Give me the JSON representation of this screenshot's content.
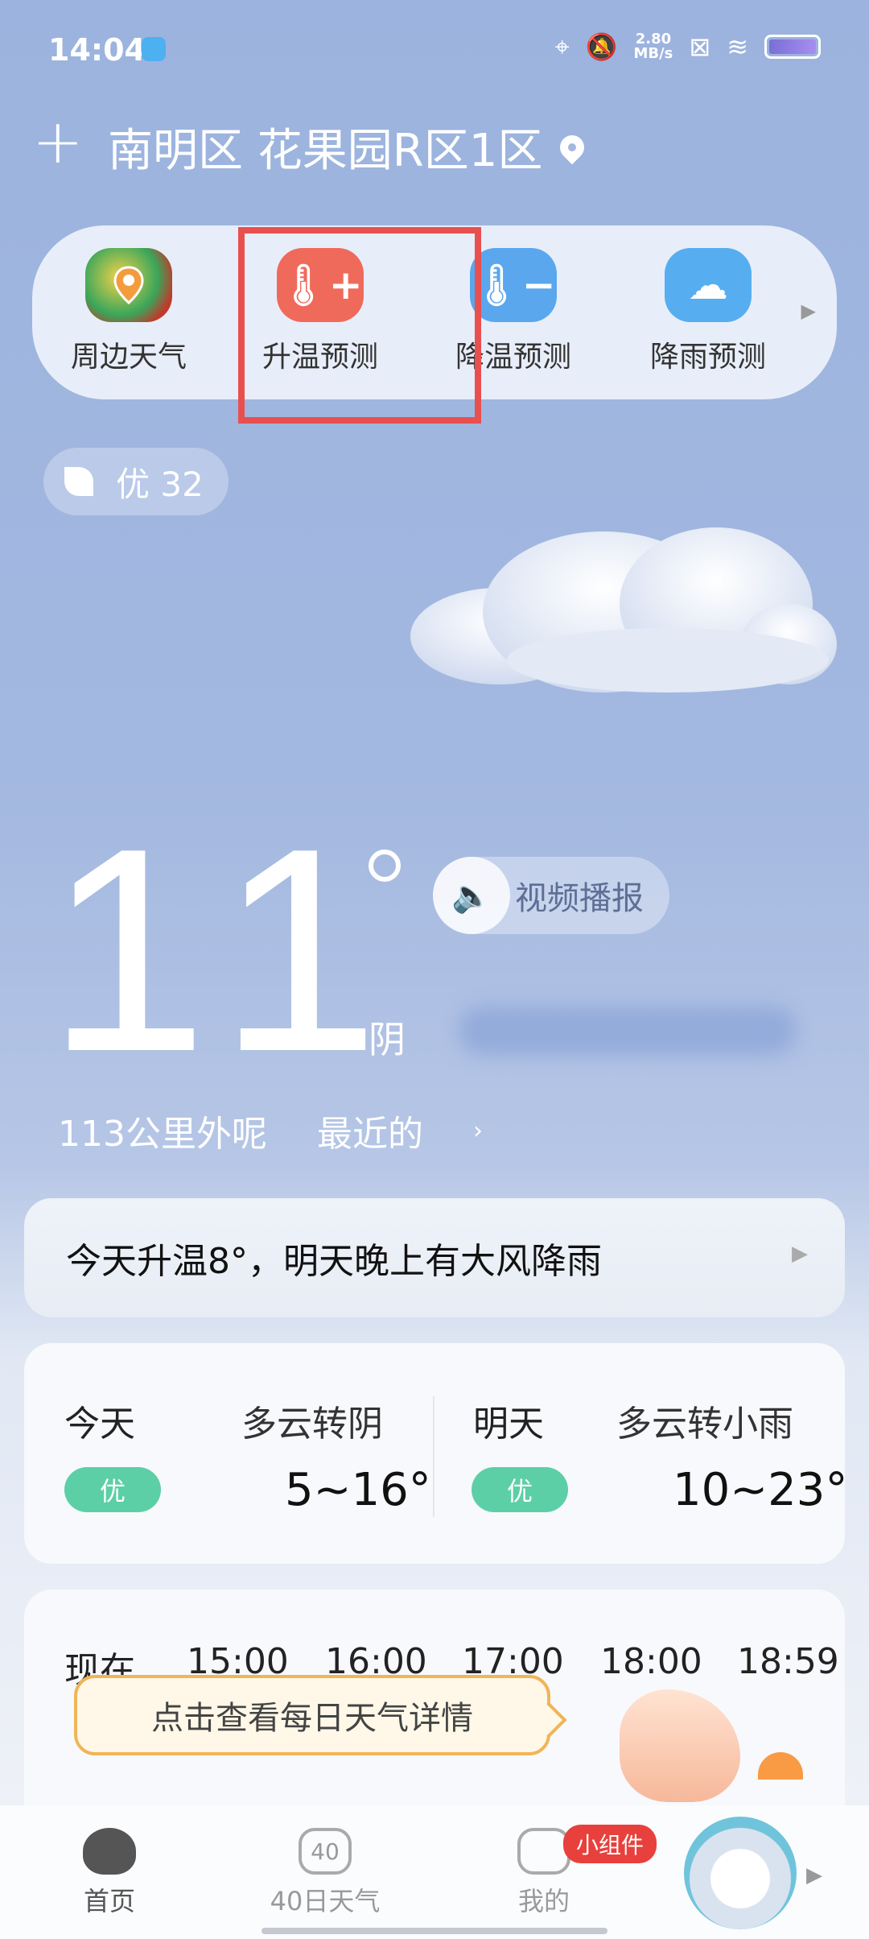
{
  "status_bar": {
    "time": "14:04",
    "net_speed_value": "2.80",
    "net_speed_unit": "MB/s"
  },
  "header": {
    "location": "南明区 花果园R区1区"
  },
  "shortcuts": [
    {
      "label": "周边天气",
      "icon": "map-pin-icon"
    },
    {
      "label": "升温预测",
      "icon": "thermometer-plus-icon"
    },
    {
      "label": "降温预测",
      "icon": "thermometer-minus-icon"
    },
    {
      "label": "降雨预测",
      "icon": "rain-cloud-icon"
    }
  ],
  "aqi": {
    "label": "优 32"
  },
  "current": {
    "temperature": "11",
    "condition": "阴",
    "video_label": "视频播报",
    "ticker_part1": "113公里外呢",
    "ticker_part2": "最近的"
  },
  "alert": {
    "text": "今天升温8°，明天晚上有大风降雨"
  },
  "forecast": {
    "today": {
      "day": "今天",
      "condition": "多云转阴",
      "aqi": "优",
      "range": "5~16°"
    },
    "tomorrow": {
      "day": "明天",
      "condition": "多云转小雨",
      "aqi": "优",
      "range": "10~23°"
    }
  },
  "hourly": {
    "hours": [
      "现在",
      "15:00",
      "16:00",
      "17:00",
      "18:00",
      "18:59"
    ],
    "tip": "点击查看每日天气详情"
  },
  "bottom_nav": {
    "items": [
      {
        "label": "首页"
      },
      {
        "label": "40日天气",
        "icon_text": "40"
      },
      {
        "label": "我的"
      }
    ],
    "badge": "小组件"
  },
  "colors": {
    "accent_warm": "#f06a5c",
    "accent_cool": "#5aa7ee",
    "aqi_good": "#5ccfa7",
    "highlight_border": "#e85050"
  }
}
